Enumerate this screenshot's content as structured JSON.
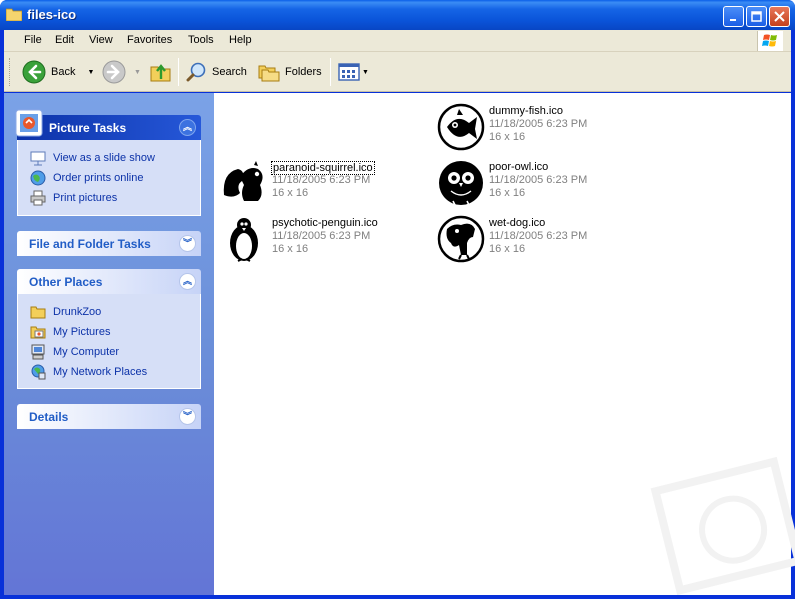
{
  "window": {
    "title": "files-ico"
  },
  "menu": {
    "items": [
      "File",
      "Edit",
      "View",
      "Favorites",
      "Tools",
      "Help"
    ]
  },
  "toolbar": {
    "back_label": "Back",
    "search_label": "Search",
    "folders_label": "Folders"
  },
  "sidebar": {
    "picture_tasks": {
      "title": "Picture Tasks",
      "items": [
        "View as a slide show",
        "Order prints online",
        "Print pictures"
      ]
    },
    "file_folder_tasks": {
      "title": "File and Folder Tasks"
    },
    "other_places": {
      "title": "Other Places",
      "items": [
        "DrunkZoo",
        "My Pictures",
        "My Computer",
        "My Network Places"
      ]
    },
    "details": {
      "title": "Details"
    }
  },
  "files": [
    {
      "name": "dummy-fish.ico",
      "date": "11/18/2005 6:23 PM",
      "dims": "16 x 16",
      "icon": "fish-icon"
    },
    {
      "name": "paranoid-squirrel.ico",
      "date": "11/18/2005 6:23 PM",
      "dims": "16 x 16",
      "icon": "squirrel-icon",
      "selected": true
    },
    {
      "name": "poor-owl.ico",
      "date": "11/18/2005 6:23 PM",
      "dims": "16 x 16",
      "icon": "owl-icon"
    },
    {
      "name": "psychotic-penguin.ico",
      "date": "11/18/2005 6:23 PM",
      "dims": "16 x 16",
      "icon": "penguin-icon"
    },
    {
      "name": "wet-dog.ico",
      "date": "11/18/2005 6:23 PM",
      "dims": "16 x 16",
      "icon": "dog-icon"
    }
  ],
  "colors": {
    "titlebar": "#0a53d8",
    "link": "#0c32a8",
    "sidebar": "#6b8fd9"
  }
}
